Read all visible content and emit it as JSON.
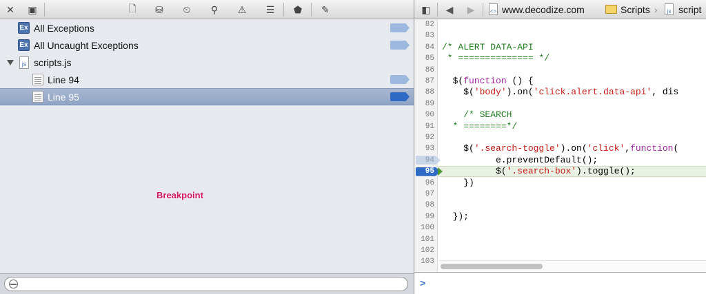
{
  "toolbar": {
    "icons": [
      "close-icon",
      "toggle-panel-icon",
      "file-icon",
      "database-icon",
      "timer-icon",
      "search-icon",
      "warning-icon",
      "list-icon",
      "breakpoint-tag-icon",
      "chat-icon"
    ]
  },
  "breakpoints": {
    "items": [
      {
        "label": "All Exceptions",
        "icon": "exception-icon",
        "selected": false
      },
      {
        "label": "All Uncaught Exceptions",
        "icon": "exception-icon",
        "selected": false
      },
      {
        "label": "scripts.js",
        "icon": "js-file-icon",
        "selected": false,
        "expanded": true
      },
      {
        "label": "Line 94",
        "icon": "source-line-icon",
        "selected": false
      },
      {
        "label": "Line 95",
        "icon": "source-line-icon",
        "selected": true
      }
    ],
    "tooltip": "Breakpoint",
    "filter_placeholder": ""
  },
  "editor": {
    "breadcrumb": [
      "www.decodize.com",
      "Scripts",
      "script"
    ],
    "line_numbers": [
      "82",
      "83",
      "84",
      "85",
      "86",
      "87",
      "88",
      "89",
      "90",
      "91",
      "92",
      "93",
      "94",
      "95",
      "96",
      "97",
      "98",
      "99",
      "100",
      "101",
      "102",
      "103"
    ],
    "breakpoint_lines": {
      "disabled": "94",
      "active": "95"
    },
    "console_prompt": ">"
  },
  "colors": {
    "selection": "#8ea3c4",
    "breakpoint_active": "#2f6bc4",
    "breakpoint_inactive": "#9cb8de",
    "comment": "#1f7a1f",
    "keyword": "#a0289e",
    "string": "#c41a16",
    "tooltip": "#d0155c"
  }
}
